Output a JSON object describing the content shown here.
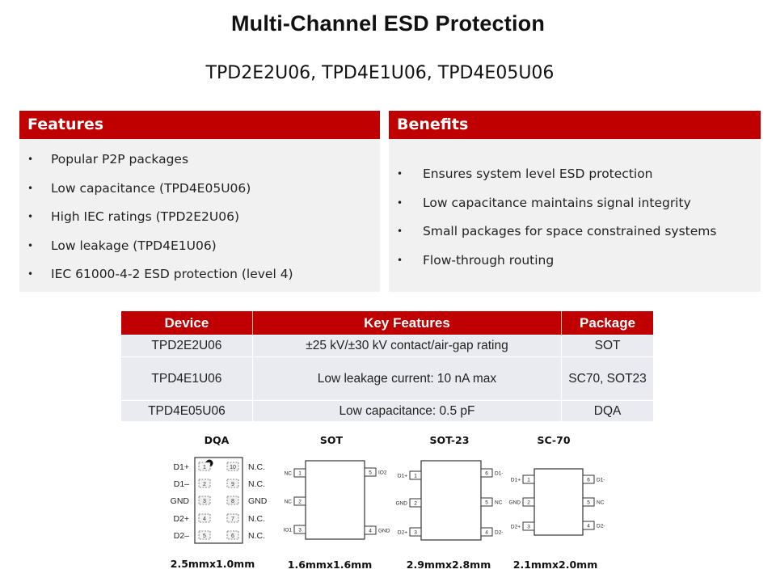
{
  "slide": {
    "title": "Multi-Channel ESD Protection",
    "subtitle": "TPD2E2U06, TPD4E1U06, TPD4E05U06",
    "accent_color": "#c00000",
    "panel_bg_color": "#f1f1f1"
  },
  "features": {
    "heading": "Features",
    "bullet": "•",
    "items": [
      "Popular P2P packages",
      "Low capacitance (TPD4E05U06)",
      "High IEC ratings (TPD2E2U06)",
      "Low leakage (TPD4E1U06)",
      "IEC 61000-4-2 ESD protection (level 4)"
    ]
  },
  "benefits": {
    "heading": "Benefits",
    "bullet": "•",
    "items": [
      "Ensures system level ESD protection",
      "Low capacitance maintains signal integrity",
      "Small packages for space constrained systems",
      "Flow-through routing"
    ]
  },
  "device_table": {
    "headers": [
      "Device",
      "Key Features",
      "Package"
    ],
    "rows": [
      [
        "TPD2E2U06",
        "±25 kV/±30 kV contact/air-gap rating",
        "SOT"
      ],
      [
        "TPD4E1U06",
        "Low leakage current: 10 nA max",
        "SC70, SOT23"
      ],
      [
        "TPD4E05U06",
        "Low capacitance: 0.5 pF",
        "DQA"
      ]
    ]
  },
  "packages": [
    {
      "name": "DQA",
      "size": "2.5mmx1.0mm",
      "left_pins": [
        {
          "num": "1",
          "label": "D1+"
        },
        {
          "num": "2",
          "label": "D1–"
        },
        {
          "num": "3",
          "label": "GND"
        },
        {
          "num": "4",
          "label": "D2+"
        },
        {
          "num": "5",
          "label": "D2–"
        }
      ],
      "right_pins": [
        {
          "num": "10",
          "label": "N.C."
        },
        {
          "num": "9",
          "label": "N.C."
        },
        {
          "num": "8",
          "label": "GND"
        },
        {
          "num": "7",
          "label": "N.C."
        },
        {
          "num": "6",
          "label": "N.C."
        }
      ]
    },
    {
      "name": "SOT",
      "size": "1.6mmx1.6mm",
      "left_pins": [
        {
          "num": "1",
          "label": "NC"
        },
        {
          "num": "2",
          "label": "NC"
        },
        {
          "num": "3",
          "label": "IO1"
        }
      ],
      "right_pins": [
        {
          "num": "5",
          "label": "IO2"
        },
        {
          "num": "4",
          "label": "GND"
        }
      ]
    },
    {
      "name": "SOT-23",
      "size": "2.9mmx2.8mm",
      "left_pins": [
        {
          "num": "1",
          "label": "D1+"
        },
        {
          "num": "2",
          "label": "GND"
        },
        {
          "num": "3",
          "label": "D2+"
        }
      ],
      "right_pins": [
        {
          "num": "6",
          "label": "D1-"
        },
        {
          "num": "5",
          "label": "NC"
        },
        {
          "num": "4",
          "label": "D2-"
        }
      ]
    },
    {
      "name": "SC-70",
      "size": "2.1mmx2.0mm",
      "left_pins": [
        {
          "num": "1",
          "label": "D1+"
        },
        {
          "num": "2",
          "label": "GND"
        },
        {
          "num": "3",
          "label": "D2+"
        }
      ],
      "right_pins": [
        {
          "num": "6",
          "label": "D1-"
        },
        {
          "num": "5",
          "label": "NC"
        },
        {
          "num": "4",
          "label": "D2-"
        }
      ]
    }
  ]
}
